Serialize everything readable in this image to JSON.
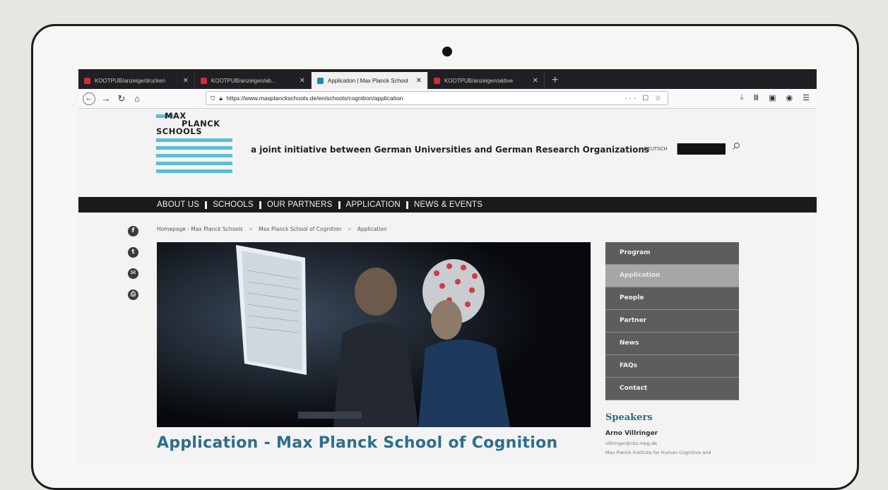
{
  "browser": {
    "tabs": [
      {
        "title": "KOOTPUB/anzeige/drucken",
        "active": false
      },
      {
        "title": "KOOTPUB/anzeigen/ab...",
        "active": false
      },
      {
        "title": "Application | Max Planck School",
        "active": true
      },
      {
        "title": "KOOTPUB/anzeigen/aktive",
        "active": false
      }
    ],
    "new_tab": "+",
    "url": "https://www.maxplanckschools.de/en/schools/cognition/application",
    "url_actions": "··· ☐ ☆"
  },
  "site": {
    "logo": {
      "line1": "MAX",
      "line2": "PLANCK",
      "line3": "SCHOOLS"
    },
    "tagline": "a joint initiative between German Universities and German Research Organizations",
    "language": "DEUTSCH",
    "nav": [
      "ABOUT US",
      "SCHOOLS",
      "OUR PARTNERS",
      "APPLICATION",
      "NEWS & EVENTS"
    ],
    "social": [
      {
        "icon": "facebook-icon",
        "glyph": "f"
      },
      {
        "icon": "twitter-icon",
        "glyph": "t"
      },
      {
        "icon": "mail-icon",
        "glyph": "✉"
      },
      {
        "icon": "print-icon",
        "glyph": "⎙"
      }
    ],
    "breadcrumb": [
      "Homepage - Max Planck Schools",
      "Max Planck School of Cognition",
      "Application"
    ],
    "breadcrumb_sep": ">",
    "sidenav": [
      {
        "label": "Program",
        "active": false
      },
      {
        "label": "Application",
        "active": true
      },
      {
        "label": "People",
        "active": false
      },
      {
        "label": "Partner",
        "active": false
      },
      {
        "label": "News",
        "active": false
      },
      {
        "label": "FAQs",
        "active": false
      },
      {
        "label": "Contact",
        "active": false
      }
    ],
    "speakers": {
      "title": "Speakers",
      "name": "Arno Villringer",
      "email": "villringer@cbs.mpg.de",
      "institution": "Max Planck Institute for Human Cognitive and"
    },
    "heading": {
      "part1": "Application",
      "dash": " - ",
      "part2": "Max Planck School of Cognition"
    }
  },
  "colors": {
    "accent": "#2e6e8c",
    "logo_stripe": "#59bfd7",
    "nav_bg": "#1b1b1b"
  }
}
